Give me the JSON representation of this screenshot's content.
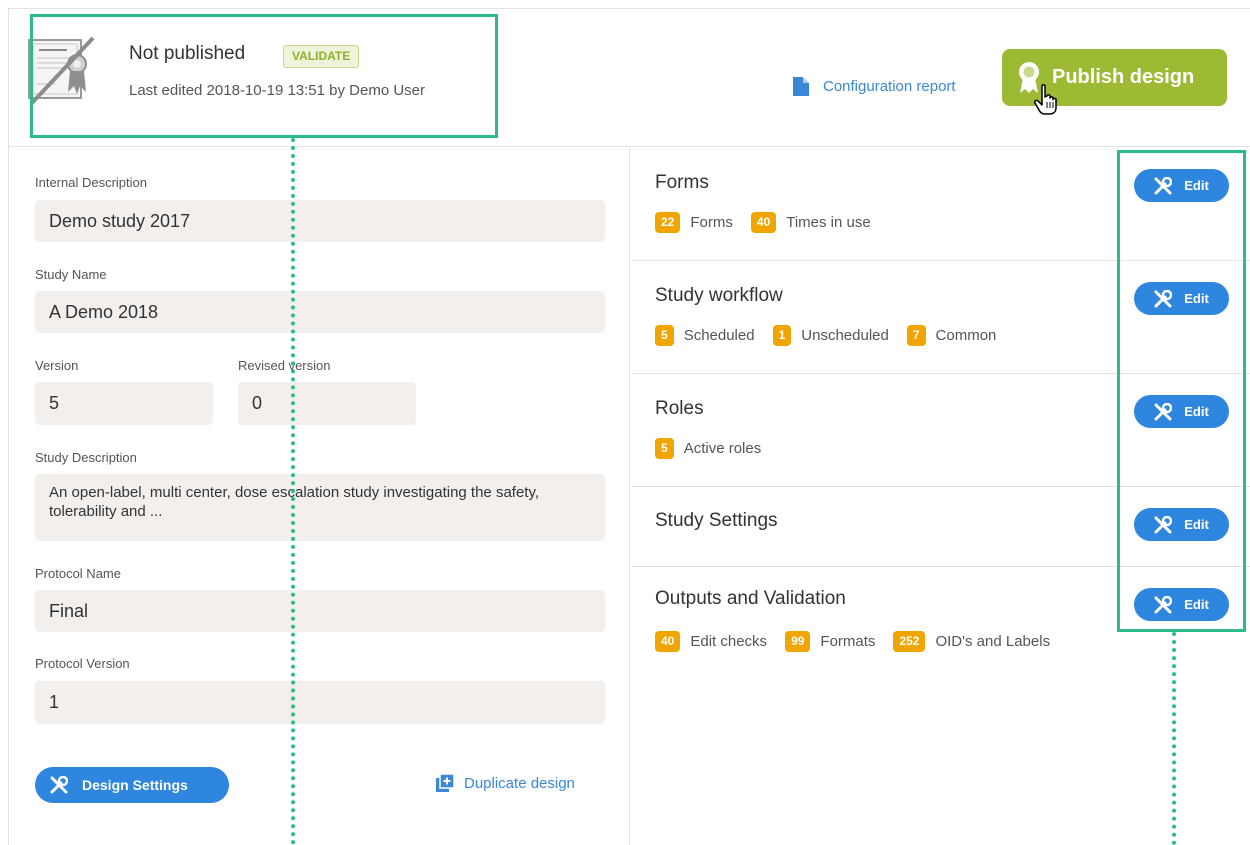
{
  "header": {
    "status": "Not published",
    "validate_badge": "VALIDATE",
    "last_edited": "Last edited 2018-10-19 13:51 by Demo User",
    "config_report": "Configuration report",
    "publish_label": "Publish design"
  },
  "details": {
    "internal_description": {
      "label": "Internal Description",
      "value": "Demo study 2017"
    },
    "study_name": {
      "label": "Study Name",
      "value": "A Demo 2018"
    },
    "version": {
      "label": "Version",
      "value": "5"
    },
    "revised_version": {
      "label": "Revised version",
      "value": "0"
    },
    "study_description": {
      "label": "Study Description",
      "value": "An open-label, multi center, dose escalation study investigating the safety, tolerability and ..."
    },
    "protocol_name": {
      "label": "Protocol Name",
      "value": "Final"
    },
    "protocol_version": {
      "label": "Protocol Version",
      "value": "1"
    },
    "design_settings_label": "Design Settings",
    "duplicate_label": "Duplicate design"
  },
  "sections": [
    {
      "title": "Forms",
      "edit": "Edit",
      "stats": [
        {
          "count": "22",
          "label": "Forms"
        },
        {
          "count": "40",
          "label": "Times in use"
        }
      ]
    },
    {
      "title": "Study workflow",
      "edit": "Edit",
      "stats": [
        {
          "count": "5",
          "label": "Scheduled"
        },
        {
          "count": "1",
          "label": "Unscheduled"
        },
        {
          "count": "7",
          "label": "Common"
        }
      ]
    },
    {
      "title": "Roles",
      "edit": "Edit",
      "stats": [
        {
          "count": "5",
          "label": "Active roles"
        }
      ]
    },
    {
      "title": "Study Settings",
      "edit": "Edit",
      "stats": []
    },
    {
      "title": "Outputs and Validation",
      "edit": "Edit",
      "stats": [
        {
          "count": "40",
          "label": "Edit checks"
        },
        {
          "count": "99",
          "label": "Formats"
        },
        {
          "count": "252",
          "label": "OID's and Labels"
        }
      ]
    }
  ],
  "colors": {
    "accent_blue": "#2e86de",
    "publish_green": "#9dba35",
    "count_orange": "#f0a500",
    "highlight_green": "#2dbb8c"
  },
  "icons": [
    "certificate-icon",
    "document-icon",
    "award-ribbon-icon",
    "hand-cursor-icon",
    "tools-icon",
    "duplicate-icon"
  ]
}
